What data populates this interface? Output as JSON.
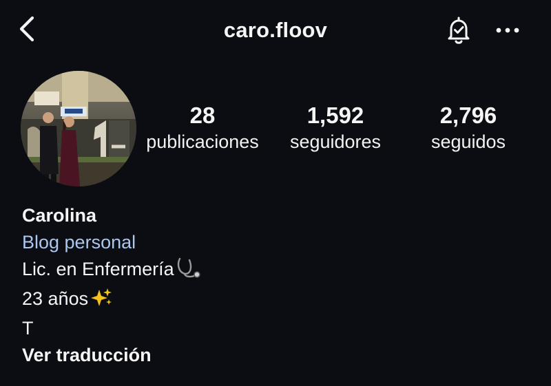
{
  "header": {
    "username": "caro.floov",
    "icons": {
      "back": "chevron-left-icon",
      "notifications": "bell-check-icon",
      "more": "more-horizontal-icon"
    }
  },
  "profile": {
    "stats": {
      "posts": {
        "count": "28",
        "label": "publicaciones"
      },
      "followers": {
        "count": "1,592",
        "label": "seguidores"
      },
      "following": {
        "count": "2,796",
        "label": "seguidos"
      }
    },
    "display_name": "Carolina",
    "category": "Blog personal",
    "bio_lines": [
      "Lic. en Enfermería",
      "23 años",
      "T"
    ],
    "translate_link": "Ver traducción"
  },
  "colors": {
    "background": "#0c0d12",
    "text": "#f5f5f5",
    "category": "#a9c7f0"
  }
}
